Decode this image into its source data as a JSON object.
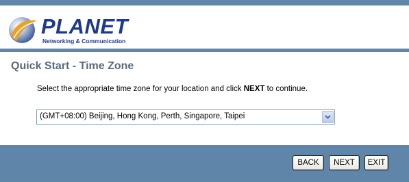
{
  "brand": {
    "name": "PLANET",
    "tagline": "Networking & Communication",
    "colors": {
      "navy": "#1d3a8c",
      "bar": "#5f85a8",
      "globe_orange": "#f0a020"
    }
  },
  "page": {
    "title": "Quick Start - Time Zone",
    "instruction_before": "Select the appropriate time zone for your location and click ",
    "instruction_emphasis": "NEXT",
    "instruction_after": " to continue."
  },
  "timezone_select": {
    "value": "(GMT+08:00) Beijing, Hong Kong, Perth, Singapore, Taipei"
  },
  "buttons": {
    "back": "BACK",
    "next": "NEXT",
    "exit": "EXIT"
  }
}
